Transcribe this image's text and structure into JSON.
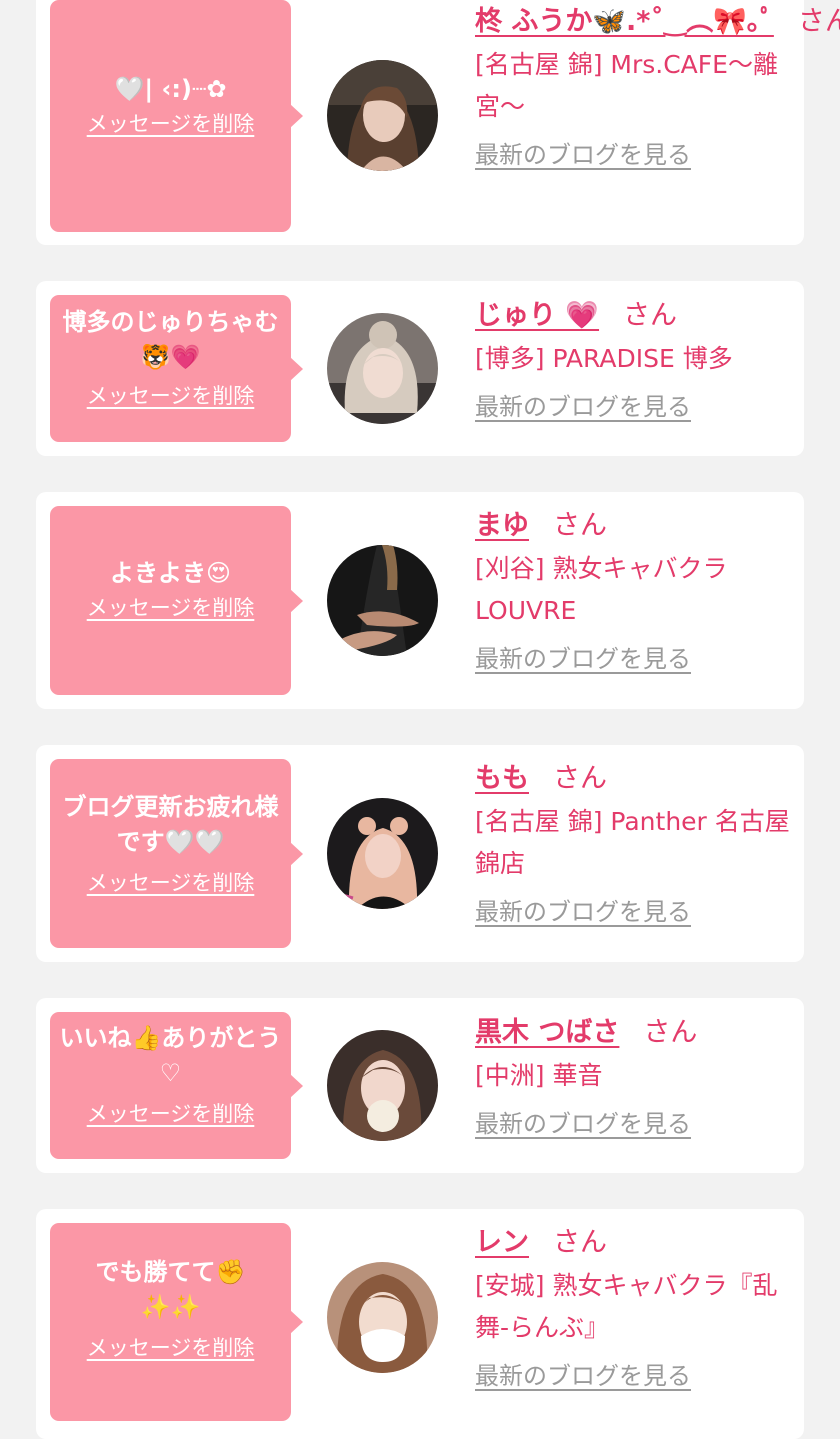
{
  "colors": {
    "page_bg": "#f2f2f2",
    "card_bg": "#ffffff",
    "bubble_bg": "#fb97a6",
    "accent": "#e33b6a",
    "link_gray": "#9a9a9a"
  },
  "delete_label": "メッセージを削除",
  "blog_link_label": "最新のブログを見る",
  "honorific": "さん",
  "cards": [
    {
      "message": "🤍| ‹:)┈✿",
      "name": "柊 ふうか🦋.*˚‿︵🎀｡ﾟ",
      "shop": "[名古屋 錦] Mrs.CAFE〜離宮〜"
    },
    {
      "message": "博多のじゅりちゃむ🐯💗",
      "name": "じゅり 💗",
      "shop": "[博多] PARADISE 博多"
    },
    {
      "message": "よきよき😍",
      "name": "まゆ",
      "shop": "[刈谷] 熟女キャバクラ LOUVRE"
    },
    {
      "message": "ブログ更新お疲れ様です🤍🤍",
      "name": "もも",
      "shop": "[名古屋 錦] Panther 名古屋錦店"
    },
    {
      "message": "いいね👍ありがとう♡",
      "name": "黒木 つばさ",
      "shop": "[中洲] 華音"
    },
    {
      "message": "でも勝てて✊\n✨✨",
      "name": "レン",
      "shop": "[安城] 熟女キャバクラ『乱舞-らんぶ』"
    }
  ]
}
